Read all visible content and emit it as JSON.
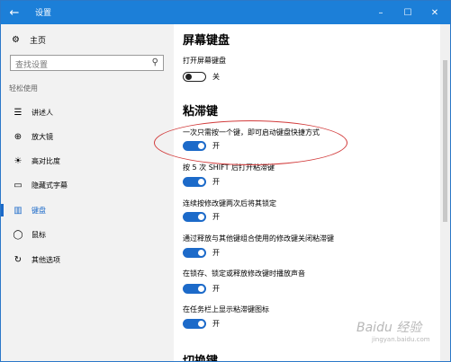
{
  "window": {
    "title": "设置",
    "back_icon": "←",
    "min_icon": "–",
    "max_icon": "☐",
    "close_icon": "✕"
  },
  "sidebar": {
    "home": {
      "icon": "⚙",
      "label": "主页"
    },
    "search": {
      "placeholder": "查找设置",
      "icon": "⚲"
    },
    "category": "轻松使用",
    "items": [
      {
        "icon": "☰",
        "label": "讲述人"
      },
      {
        "icon": "⊕",
        "label": "放大镜"
      },
      {
        "icon": "☀",
        "label": "高对比度"
      },
      {
        "icon": "▭",
        "label": "隐藏式字幕"
      },
      {
        "icon": "▥",
        "label": "键盘",
        "active": true
      },
      {
        "icon": "◯",
        "label": "鼠标"
      },
      {
        "icon": "↻",
        "label": "其他选项"
      }
    ]
  },
  "main": {
    "section1": {
      "title": "屏幕键盘",
      "setting": {
        "label": "打开屏幕键盘",
        "state": "关"
      }
    },
    "section2": {
      "title": "粘滞键",
      "settings": [
        {
          "label": "一次只需按一个键，即可启动键盘快捷方式",
          "state": "开"
        },
        {
          "label": "按 5 次 SHIFT 后打开粘滞键",
          "state": "开"
        },
        {
          "label": "连续按修改键两次后将其锁定",
          "state": "开"
        },
        {
          "label": "通过释放与其他键组合使用的修改键关闭粘滞键",
          "state": "开"
        },
        {
          "label": "在锁存、锁定或释放修改键时播放声音",
          "state": "开"
        },
        {
          "label": "在任务栏上显示粘滞键图标",
          "state": "开"
        }
      ]
    },
    "section3_title_partial": "切换键"
  },
  "watermark": {
    "text": "Baidu 经验",
    "url": "jingyan.baidu.com"
  },
  "colors": {
    "accent": "#1c6ac9",
    "titlebar": "#1c7fd8",
    "annotation": "#d23c3c"
  }
}
